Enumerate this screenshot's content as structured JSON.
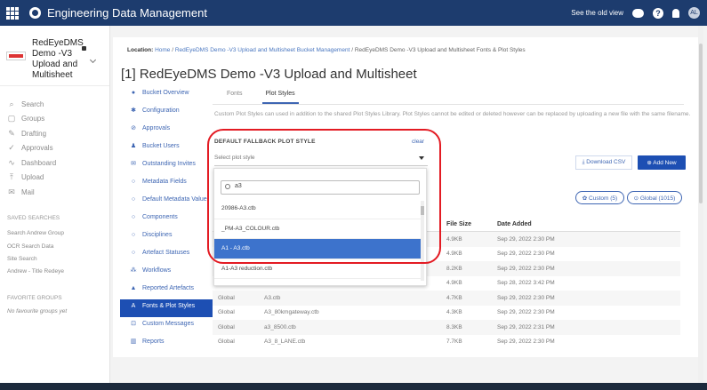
{
  "app": {
    "title": "Engineering Data Management",
    "see_old_view": "See the old view",
    "help_glyph": "?",
    "avatar_initials": "AL",
    "icons": [
      "apps-grid-icon",
      "gear-logo-icon",
      "chat-icon",
      "help-icon",
      "bell-icon",
      "avatar"
    ]
  },
  "sidebar": {
    "project_name": "RedEyeDMS Demo -V3 Upload and Multisheet",
    "nav": [
      {
        "label": "Search",
        "icon": "search-icon",
        "glyph": "⌕"
      },
      {
        "label": "Groups",
        "icon": "groups-icon",
        "glyph": "▢"
      },
      {
        "label": "Drafting",
        "icon": "pencil-icon",
        "glyph": "✎"
      },
      {
        "label": "Approvals",
        "icon": "check-icon",
        "glyph": "✓"
      },
      {
        "label": "Dashboard",
        "icon": "chart-icon",
        "glyph": "∿"
      },
      {
        "label": "Upload",
        "icon": "upload-icon",
        "glyph": "⤒"
      },
      {
        "label": "Mail",
        "icon": "mail-icon",
        "glyph": "✉"
      }
    ],
    "saved_searches_title": "SAVED SEARCHES",
    "saved_searches": [
      "Search Andrew Group",
      "OCR Search Data",
      "Site Search",
      "Andrew - Title Redeye"
    ],
    "favorite_groups_title": "FAVORITE GROUPS",
    "favorite_groups_empty": "No favourite groups yet"
  },
  "main": {
    "breadcrumb": {
      "label": "Location:",
      "home": "Home",
      "sep": "/",
      "project": "RedEyeDMS Demo -V3 Upload and Multisheet Bucket Management",
      "current": "RedEyeDMS Demo -V3 Upload and Multisheet Fonts & Plot Styles"
    },
    "title": "[1] RedEyeDMS Demo -V3 Upload and Multisheet",
    "subnav": [
      {
        "label": "Bucket Overview",
        "icon": "info-icon",
        "glyph": "●",
        "active": false
      },
      {
        "label": "Configuration",
        "icon": "gear-icon",
        "glyph": "✱",
        "active": false
      },
      {
        "label": "Approvals",
        "icon": "check-circle-icon",
        "glyph": "⊘",
        "active": false
      },
      {
        "label": "Bucket Users",
        "icon": "user-icon",
        "glyph": "♟",
        "active": false
      },
      {
        "label": "Outstanding Invites",
        "icon": "envelope-icon",
        "glyph": "✉",
        "active": false
      },
      {
        "label": "Metadata Fields",
        "icon": "circle-icon",
        "glyph": "○",
        "active": false
      },
      {
        "label": "Default Metadata Value",
        "icon": "circle-icon",
        "glyph": "○",
        "active": false
      },
      {
        "label": "Components",
        "icon": "circle-icon",
        "glyph": "○",
        "active": false
      },
      {
        "label": "Disciplines",
        "icon": "circle-icon",
        "glyph": "○",
        "active": false
      },
      {
        "label": "Artefact Statuses",
        "icon": "circle-icon",
        "glyph": "○",
        "active": false
      },
      {
        "label": "Workflows",
        "icon": "workflow-icon",
        "glyph": "⁂",
        "active": false
      },
      {
        "label": "Reported Artefacts",
        "icon": "warning-icon",
        "glyph": "▲",
        "active": false
      },
      {
        "label": "Fonts & Plot Styles",
        "icon": "font-icon",
        "glyph": "A",
        "active": true
      },
      {
        "label": "Custom Messages",
        "icon": "message-icon",
        "glyph": "⊡",
        "active": false
      },
      {
        "label": "Reports",
        "icon": "report-icon",
        "glyph": "▥",
        "active": false
      }
    ],
    "tabs": [
      {
        "label": "Fonts",
        "active": false
      },
      {
        "label": "Plot Styles",
        "active": true
      }
    ],
    "description": "Custom Plot Styles can used in addition to the shared Plot Styles Library. Plot Styles cannot be edited or deleted however can be replaced by uploading a new file with the same filename.",
    "fallback": {
      "label": "DEFAULT FALLBACK PLOT STYLE",
      "clear": "clear",
      "placeholder": "Select plot style"
    },
    "buttons": {
      "download_csv": "⤓ Download CSV",
      "add_new": "⊕ Add New"
    },
    "filters": {
      "custom": "✿ Custom (5)",
      "global": "⊙ Global (1015)"
    },
    "table": {
      "headers": [
        "",
        "",
        "File Size",
        "Date Added"
      ],
      "rows": [
        {
          "scope": "",
          "name": "",
          "size": "4.9KB",
          "date": "Sep 29, 2022 2:30 PM"
        },
        {
          "scope": "",
          "name": "",
          "size": "4.9KB",
          "date": "Sep 29, 2022 2:30 PM"
        },
        {
          "scope": "",
          "name": "",
          "size": "8.2KB",
          "date": "Sep 29, 2022 2:30 PM"
        },
        {
          "scope": "",
          "name": "",
          "size": "4.9KB",
          "date": "Sep 28, 2022 3:42 PM"
        },
        {
          "scope": "Global",
          "name": "A3.ctb",
          "size": "4.7KB",
          "date": "Sep 29, 2022 2:30 PM"
        },
        {
          "scope": "Global",
          "name": "A3_80kmgateway.ctb",
          "size": "4.3KB",
          "date": "Sep 29, 2022 2:30 PM"
        },
        {
          "scope": "Global",
          "name": "a3_8500.ctb",
          "size": "8.3KB",
          "date": "Sep 29, 2022 2:31 PM"
        },
        {
          "scope": "Global",
          "name": "A3_8_LANE.ctb",
          "size": "7.7KB",
          "date": "Sep 29, 2022 2:30 PM"
        }
      ]
    },
    "dropdown": {
      "search_value": "a3",
      "options": [
        {
          "label": "20986-A3.ctb",
          "selected": false
        },
        {
          "label": "_PM-A3_COLOUR.ctb",
          "selected": false
        },
        {
          "label": "A1 - A3.ctb",
          "selected": true
        },
        {
          "label": "A1-A3 reduction.ctb",
          "selected": false
        }
      ]
    },
    "highlight_color": "#e31b23",
    "accent_color": "#1d4fb3"
  }
}
